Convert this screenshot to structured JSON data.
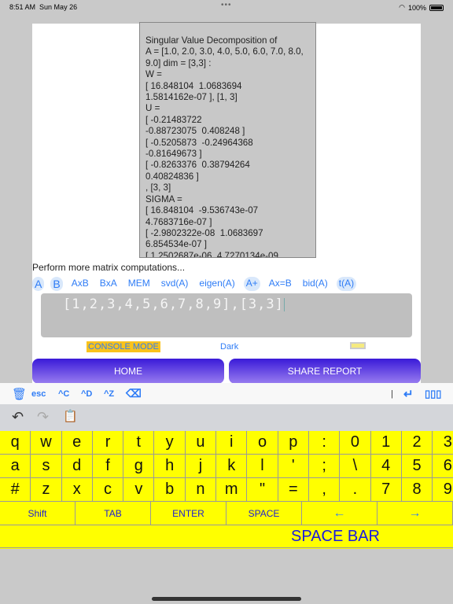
{
  "status": {
    "time": "8:51 AM",
    "date": "Sun May 26",
    "battery": "100%",
    "battery_level": 100
  },
  "output_text": "Singular Value Decomposition of\nA = [1.0, 2.0, 3.0, 4.0, 5.0, 6.0, 7.0, 8.0,\n9.0] dim = [3,3] :\nW =\n[ 16.848104  1.0683694\n1.5814162e-07 ], [1, 3]\nU =\n[ -0.21483722\n-0.88723075  0.408248 ]\n[ -0.5205873  -0.24964368\n-0.81649673 ]\n[ -0.8263376  0.38794264\n0.40824836 ]\n, [3, 3]\nSIGMA =\n[ 16.848104  -9.536743e-07\n4.7683716e-07 ]\n[ -2.9802322e-08  1.0683697\n6.854534e-07 ]\n[ 1.2502687e-06  4.7270134e-09",
  "prompt": "Perform more matrix computations...",
  "chips": [
    {
      "label": "A",
      "active": true
    },
    {
      "label": "B",
      "active": true
    },
    {
      "label": "AxB",
      "active": false
    },
    {
      "label": "BxA",
      "active": false
    },
    {
      "label": "MEM",
      "active": false
    },
    {
      "label": "svd(A)",
      "active": false
    },
    {
      "label": "eigen(A)",
      "active": false
    },
    {
      "label": "A+",
      "active": true
    },
    {
      "label": "Ax=B",
      "active": false
    },
    {
      "label": "bid(A)",
      "active": false
    },
    {
      "label": "t(A)",
      "active": true
    }
  ],
  "input_value": "[1,2,3,4,5,6,7,8,9],[3,3]",
  "console_mode": "CONSOLE MODE",
  "dark": "Dark",
  "home": "HOME",
  "share": "SHARE REPORT",
  "accessory": {
    "esc": "esc",
    "ctrl_c": "^C",
    "ctrl_d": "^D",
    "ctrl_z": "^Z"
  },
  "keyboard": {
    "rows": [
      [
        "q",
        "w",
        "e",
        "r",
        "t",
        "y",
        "u",
        "i",
        "o",
        "p",
        ":",
        "0",
        "1",
        "2",
        "3"
      ],
      [
        "a",
        "s",
        "d",
        "f",
        "g",
        "h",
        "j",
        "k",
        "l",
        "'",
        ";",
        "\\",
        "4",
        "5",
        "6"
      ],
      [
        "#",
        "z",
        "x",
        "c",
        "v",
        "b",
        "n",
        "m",
        "\"",
        "=",
        ",",
        ".",
        "7",
        "8",
        "9"
      ]
    ],
    "function_keys": [
      "Shift",
      "TAB",
      "ENTER",
      "SPACE",
      "←",
      "→"
    ],
    "space_bar": "SPACE BAR"
  },
  "colors": {
    "accent": "#2e7cf6",
    "keyboard": "#ffff00",
    "console_badge": "#fac31b",
    "button_top": "#3a1ad8",
    "button_bottom": "#9a7ef0"
  }
}
